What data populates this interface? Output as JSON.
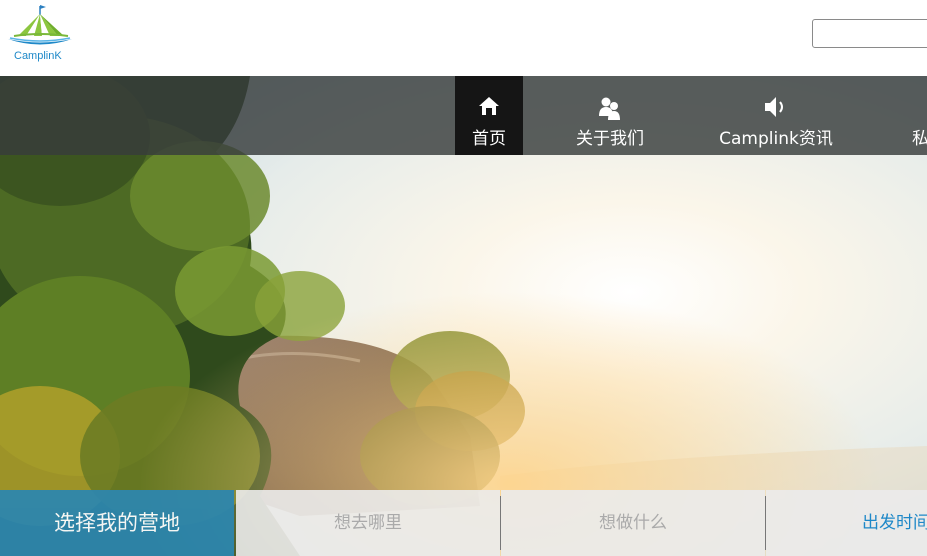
{
  "header": {
    "logo_text": "CamplinK",
    "search_placeholder": ""
  },
  "nav": {
    "items": [
      {
        "label": "首页",
        "icon": "home-icon"
      },
      {
        "label": "关于我们",
        "icon": "users-icon"
      },
      {
        "label": "Camplink资讯",
        "icon": "speaker-icon"
      },
      {
        "label": "私",
        "icon": ""
      }
    ]
  },
  "camp_search": {
    "title": "选择我的营地",
    "fields": [
      "想去哪里",
      "想做什么",
      "出发时间"
    ]
  },
  "colors": {
    "accent": "#2d86ad",
    "link": "#1e88c8",
    "nav_active": "#151515"
  }
}
